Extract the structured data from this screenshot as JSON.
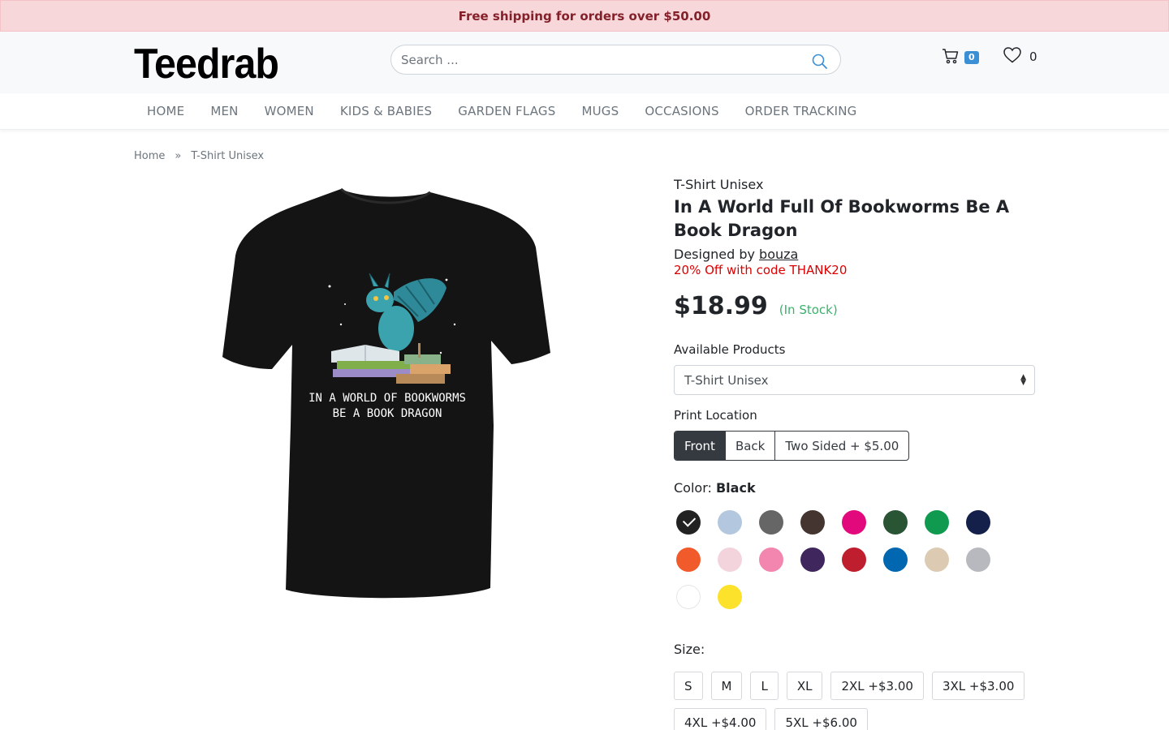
{
  "promo": {
    "text": "Free shipping for orders over $50.00"
  },
  "header": {
    "logo": "Teedrab",
    "search_placeholder": "Search ...",
    "cart_count": "0",
    "wishlist_count": "0"
  },
  "nav": {
    "items": [
      {
        "label": "HOME"
      },
      {
        "label": "MEN"
      },
      {
        "label": "WOMEN"
      },
      {
        "label": "KIDS & BABIES"
      },
      {
        "label": "GARDEN FLAGS"
      },
      {
        "label": "MUGS"
      },
      {
        "label": "OCCASIONS"
      },
      {
        "label": "ORDER TRACKING"
      }
    ]
  },
  "breadcrumb": {
    "home": "Home",
    "separator": "»",
    "current": "T-Shirt Unisex"
  },
  "product": {
    "type": "T-Shirt Unisex",
    "title": "In A World Full Of Bookworms Be A Book Dragon",
    "designed_by_label": "Designed by",
    "designer": "bouza",
    "coupon": "20% Off with code THANK20",
    "price": "$18.99",
    "stock": "(In Stock)",
    "shirt_print_text": [
      "IN A WORLD OF BOOKWORMS",
      "BE A BOOK DRAGON"
    ],
    "shirt_color": "#141414"
  },
  "options": {
    "available_products_label": "Available Products",
    "available_products_value": "T-Shirt Unisex",
    "print_location_label": "Print Location",
    "print_locations": [
      "Front",
      "Back",
      "Two Sided + $5.00"
    ],
    "print_location_selected": "Front",
    "color_label": "Color:",
    "color_selected": "Black",
    "colors": [
      {
        "name": "Black",
        "hex": "#222222"
      },
      {
        "name": "Light Blue",
        "hex": "#b3c8de"
      },
      {
        "name": "Charcoal",
        "hex": "#666666"
      },
      {
        "name": "Dark Chocolate",
        "hex": "#453530"
      },
      {
        "name": "Heliconia",
        "hex": "#e2097c"
      },
      {
        "name": "Forest Green",
        "hex": "#2a5535"
      },
      {
        "name": "Kelly Green",
        "hex": "#109a50"
      },
      {
        "name": "Navy",
        "hex": "#142049"
      },
      {
        "name": "Orange",
        "hex": "#f15b2c"
      },
      {
        "name": "Light Pink",
        "hex": "#f3d4dd"
      },
      {
        "name": "Azalea",
        "hex": "#f286ae"
      },
      {
        "name": "Purple",
        "hex": "#3f275e"
      },
      {
        "name": "Red",
        "hex": "#be1e2d"
      },
      {
        "name": "Royal",
        "hex": "#0067b0"
      },
      {
        "name": "Sand",
        "hex": "#dccbb2"
      },
      {
        "name": "Sport Grey",
        "hex": "#b8b9be"
      },
      {
        "name": "White",
        "hex": "#ffffff"
      },
      {
        "name": "Daisy",
        "hex": "#fde22b"
      }
    ],
    "size_label": "Size:",
    "sizes": [
      "S",
      "M",
      "L",
      "XL",
      "2XL +$3.00",
      "3XL +$3.00",
      "4XL +$4.00",
      "5XL +$6.00"
    ]
  }
}
